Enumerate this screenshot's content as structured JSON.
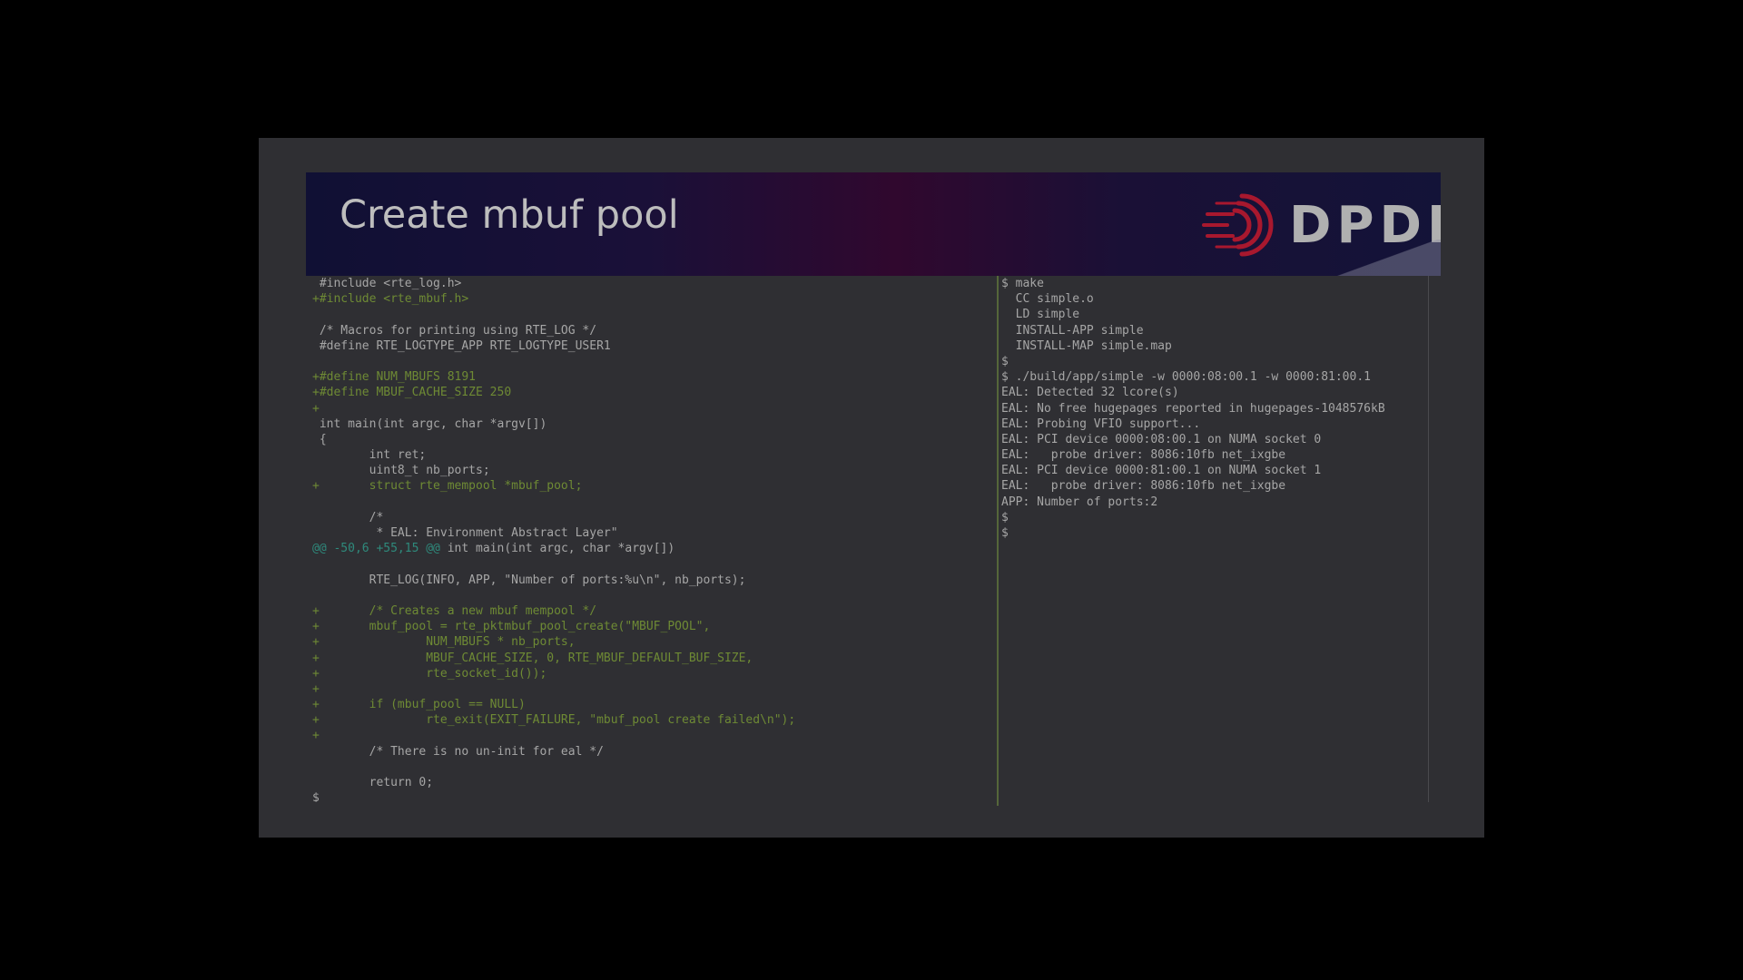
{
  "slide": {
    "title": "Create mbuf pool",
    "logo_text": "DPDK",
    "logo_icon": "dpdk-logo-icon"
  },
  "colors": {
    "page_background": "#000000",
    "slide_background": "#2f2f33",
    "header_left": "#101034",
    "header_mid": "#30082e",
    "logo_accent": "#a8182e",
    "diff_added": "#6e8a34",
    "diff_hunk": "#2f8a7c",
    "divider": "#55663a"
  },
  "editor": {
    "lines": [
      {
        "text": " #include <rte_log.h>",
        "type": "context"
      },
      {
        "text": "+#include <rte_mbuf.h>",
        "type": "added"
      },
      {
        "text": "",
        "type": "context"
      },
      {
        "text": " /* Macros for printing using RTE_LOG */",
        "type": "context"
      },
      {
        "text": " #define RTE_LOGTYPE_APP RTE_LOGTYPE_USER1",
        "type": "context"
      },
      {
        "text": "",
        "type": "context"
      },
      {
        "text": "+#define NUM_MBUFS 8191",
        "type": "added"
      },
      {
        "text": "+#define MBUF_CACHE_SIZE 250",
        "type": "added"
      },
      {
        "text": "+",
        "type": "added"
      },
      {
        "text": " int main(int argc, char *argv[])",
        "type": "context"
      },
      {
        "text": " {",
        "type": "context"
      },
      {
        "text": "        int ret;",
        "type": "context"
      },
      {
        "text": "        uint8_t nb_ports;",
        "type": "context"
      },
      {
        "text": "+       struct rte_mempool *mbuf_pool;",
        "type": "added"
      },
      {
        "text": "",
        "type": "context"
      },
      {
        "text": "        /*",
        "type": "context"
      },
      {
        "text": "         * EAL: Environment Abstract Layer\"",
        "type": "context"
      },
      {
        "text": "@@ -50,6 +55,15 @@ int main(int argc, char *argv[])",
        "type": "hunk"
      },
      {
        "text": "",
        "type": "context"
      },
      {
        "text": "        RTE_LOG(INFO, APP, \"Number of ports:%u\\n\", nb_ports);",
        "type": "context"
      },
      {
        "text": "",
        "type": "context"
      },
      {
        "text": "+       /* Creates a new mbuf mempool */",
        "type": "added"
      },
      {
        "text": "+       mbuf_pool = rte_pktmbuf_pool_create(\"MBUF_POOL\",",
        "type": "added"
      },
      {
        "text": "+               NUM_MBUFS * nb_ports,",
        "type": "added"
      },
      {
        "text": "+               MBUF_CACHE_SIZE, 0, RTE_MBUF_DEFAULT_BUF_SIZE,",
        "type": "added"
      },
      {
        "text": "+               rte_socket_id());",
        "type": "added"
      },
      {
        "text": "+",
        "type": "added"
      },
      {
        "text": "+       if (mbuf_pool == NULL)",
        "type": "added"
      },
      {
        "text": "+               rte_exit(EXIT_FAILURE, \"mbuf_pool create failed\\n\");",
        "type": "added"
      },
      {
        "text": "+",
        "type": "added"
      },
      {
        "text": "        /* There is no un-init for eal */",
        "type": "context"
      },
      {
        "text": "",
        "type": "context"
      },
      {
        "text": "        return 0;",
        "type": "context"
      },
      {
        "text": "$",
        "type": "context"
      }
    ]
  },
  "terminal": {
    "lines": [
      "$ make",
      "  CC simple.o",
      "  LD simple",
      "  INSTALL-APP simple",
      "  INSTALL-MAP simple.map",
      "$",
      "$ ./build/app/simple -w 0000:08:00.1 -w 0000:81:00.1",
      "EAL: Detected 32 lcore(s)",
      "EAL: No free hugepages reported in hugepages-1048576kB",
      "EAL: Probing VFIO support...",
      "EAL: PCI device 0000:08:00.1 on NUMA socket 0",
      "EAL:   probe driver: 8086:10fb net_ixgbe",
      "EAL: PCI device 0000:81:00.1 on NUMA socket 1",
      "EAL:   probe driver: 8086:10fb net_ixgbe",
      "APP: Number of ports:2",
      "$",
      "$"
    ]
  }
}
